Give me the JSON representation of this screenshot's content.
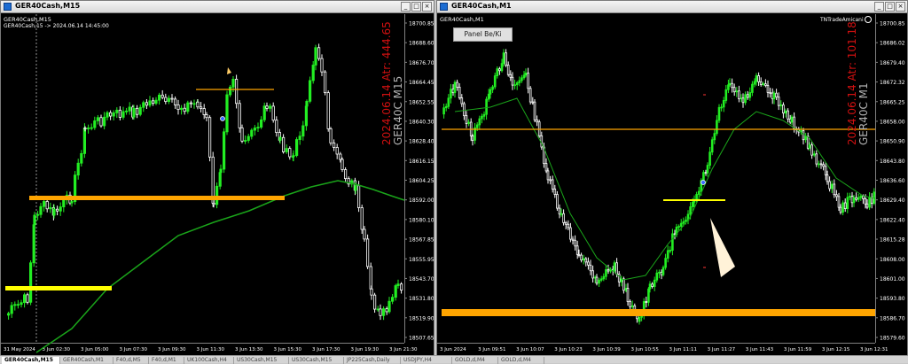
{
  "colors": {
    "bull": "#22ee22",
    "bear": "#ffffff",
    "ma": "#1aa41a",
    "orange": "#ffa500",
    "yellow": "#ffff00",
    "red_text": "#d01010",
    "grey_text": "#b0b0b0",
    "bg": "#000000"
  },
  "left": {
    "window_title": "GER40Cash,M15",
    "symbol_label": "GER40Cash,M15",
    "info_label": "GER40Cash,15 -> 2024.06.14 14:45:00",
    "vertical_red": "2024.06.14 Atr: 444.65",
    "vertical_grey": "GER40C M15",
    "price_ticks": [
      "18700.85",
      "18688.60",
      "18676.70",
      "18664.45",
      "18652.55",
      "18640.30",
      "18628.40",
      "18616.15",
      "18604.25",
      "18592.00",
      "18580.10",
      "18567.85",
      "18555.95",
      "18543.70",
      "18531.80",
      "18519.90",
      "18507.65"
    ],
    "time_labels": [
      "31 May 2024",
      "3 Jun 02:30",
      "3 Jun 05:00",
      "3 Jun 07:30",
      "3 Jun 09:30",
      "3 Jun 11:30",
      "3 Jun 13:30",
      "3 Jun 15:30",
      "3 Jun 17:30",
      "3 Jun 19:30",
      "3 Jun 21:30"
    ]
  },
  "right": {
    "window_title": "GER40Cash,M1",
    "symbol_label": "GER40Cash,M1",
    "panel_button": "Panel Be/Ki",
    "brand": "TNTradeAmicani",
    "vertical_red": "2024.06.14 Atr: 101.18",
    "vertical_grey": "GER40C M1",
    "price_ticks": [
      "18700.85",
      "18686.02",
      "18679.40",
      "18672.32",
      "18665.25",
      "18658.00",
      "18650.90",
      "18643.80",
      "18636.60",
      "18629.40",
      "18622.40",
      "18615.28",
      "18608.00",
      "18601.00",
      "18593.80",
      "18586.70",
      "18579.60"
    ],
    "time_labels": [
      "3 Jun 2024",
      "3 Jun 09:51",
      "3 Jun 10:07",
      "3 Jun 10:23",
      "3 Jun 10:39",
      "3 Jun 10:55",
      "3 Jun 11:11",
      "3 Jun 11:27",
      "3 Jun 11:43",
      "3 Jun 11:59",
      "3 Jun 12:15",
      "3 Jun 12:31"
    ]
  },
  "tabs": [
    "GER40Cash,M15",
    "GER40Cash,M1",
    "F40,d,M5",
    "F40,d,M1",
    "UK100Cash,H4",
    "US30Cash,M15",
    "US30Cash,M15",
    "JP225Cash,Daily",
    "USDJPY,H4",
    "GOLD,d,M4",
    "GOLD,d,M4"
  ]
}
